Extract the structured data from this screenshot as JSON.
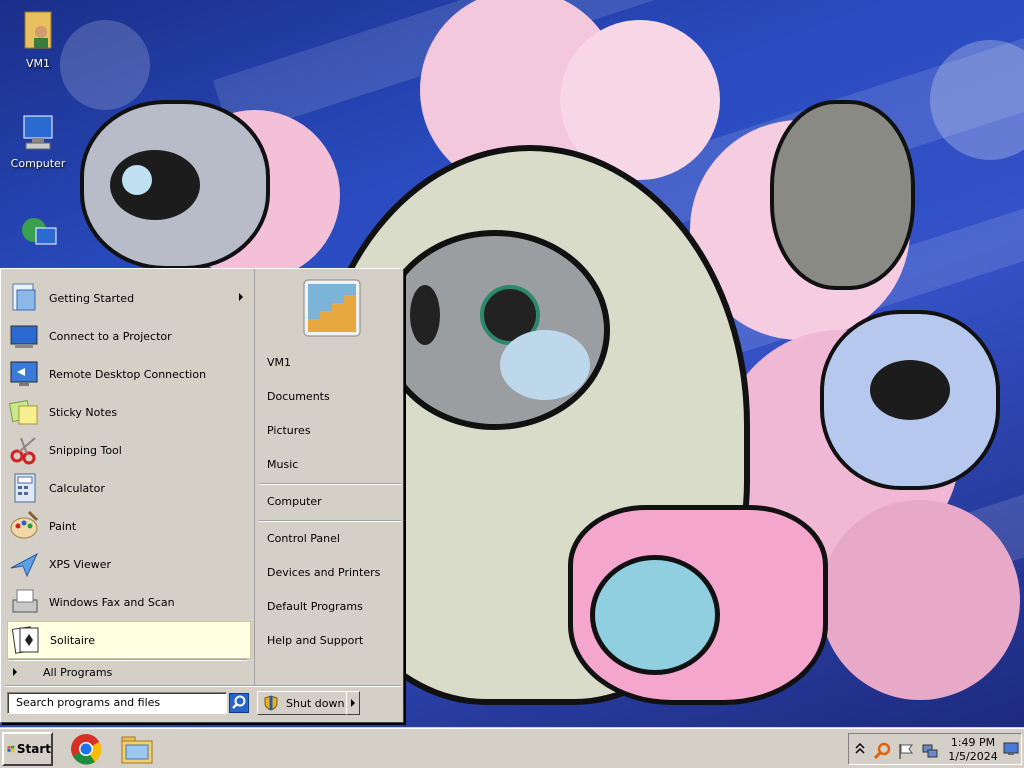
{
  "desktop": {
    "icons": [
      {
        "label": "VM1",
        "icon": "user-folder-icon"
      },
      {
        "label": "Computer",
        "icon": "computer-icon"
      },
      {
        "label": "",
        "icon": "network-icon"
      }
    ]
  },
  "start_menu": {
    "programs": [
      {
        "label": "Getting Started",
        "icon": "getting-started-icon",
        "submenu": true
      },
      {
        "label": "Connect to a Projector",
        "icon": "projector-icon"
      },
      {
        "label": "Remote Desktop Connection",
        "icon": "remote-desktop-icon"
      },
      {
        "label": "Sticky Notes",
        "icon": "sticky-notes-icon"
      },
      {
        "label": "Snipping Tool",
        "icon": "scissors-icon"
      },
      {
        "label": "Calculator",
        "icon": "calculator-icon"
      },
      {
        "label": "Paint",
        "icon": "paint-palette-icon"
      },
      {
        "label": "XPS Viewer",
        "icon": "xps-viewer-icon"
      },
      {
        "label": "Windows Fax and Scan",
        "icon": "fax-icon"
      },
      {
        "label": "Solitaire",
        "icon": "playing-cards-icon",
        "highlighted": true
      }
    ],
    "all_programs": "All Programs",
    "user_picture_icon": "stairs-picture-icon",
    "right_items": {
      "user": "VM1",
      "documents": "Documents",
      "pictures": "Pictures",
      "music": "Music",
      "computer": "Computer",
      "control_panel": "Control Panel",
      "devices": "Devices and Printers",
      "defaults": "Default Programs",
      "help": "Help and Support"
    },
    "search_placeholder": "Search programs and files",
    "shutdown_label": "Shut down"
  },
  "taskbar": {
    "start_label": "Start",
    "pinned": [
      {
        "name": "Google Chrome",
        "icon": "chrome-icon"
      },
      {
        "name": "Windows Explorer",
        "icon": "folder-icon"
      }
    ],
    "tray_icons": [
      "chevron-up-icon",
      "search-magnifier-icon",
      "flag-icon",
      "network-tray-icon"
    ],
    "time": "1:49 PM",
    "date": "1/5/2024"
  },
  "colors": {
    "accent_blue": "#2766c4",
    "menu_face": "#d4d0c8",
    "highlight": "#ffffe1"
  }
}
